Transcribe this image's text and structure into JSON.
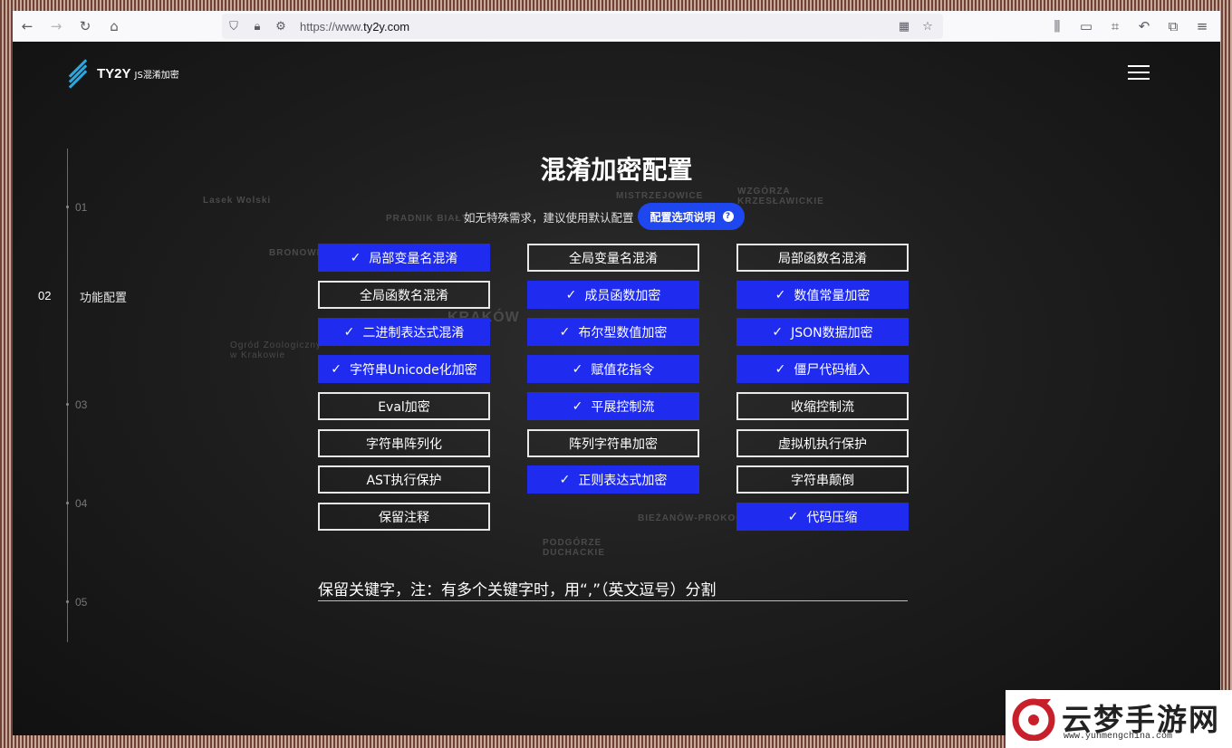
{
  "browser": {
    "url_scheme": "https://www.",
    "url_host": "ty2y.com"
  },
  "site": {
    "logo_name": "TY2Y",
    "logo_sub": "JS混淆加密"
  },
  "steps": [
    "01",
    "02",
    "03",
    "04",
    "05"
  ],
  "active_step": {
    "num": "02",
    "label": "功能配置"
  },
  "main": {
    "title": "混淆加密配置",
    "hint": "如无特殊需求，建议使用默认配置",
    "help_button": "配置选项说明",
    "help_icon": "?"
  },
  "options": {
    "col1": [
      {
        "label": "局部变量名混淆",
        "checked": true
      },
      {
        "label": "全局函数名混淆",
        "checked": false
      },
      {
        "label": "二进制表达式混淆",
        "checked": true
      },
      {
        "label": "字符串Unicode化加密",
        "checked": true
      },
      {
        "label": "Eval加密",
        "checked": false
      },
      {
        "label": "字符串阵列化",
        "checked": false
      },
      {
        "label": "AST执行保护",
        "checked": false
      },
      {
        "label": "保留注释",
        "checked": false
      }
    ],
    "col2": [
      {
        "label": "全局变量名混淆",
        "checked": false
      },
      {
        "label": "成员函数加密",
        "checked": true
      },
      {
        "label": "布尔型数值加密",
        "checked": true
      },
      {
        "label": "赋值花指令",
        "checked": true
      },
      {
        "label": "平展控制流",
        "checked": true
      },
      {
        "label": "阵列字符串加密",
        "checked": false
      },
      {
        "label": "正则表达式加密",
        "checked": true
      }
    ],
    "col3": [
      {
        "label": "局部函数名混淆",
        "checked": false
      },
      {
        "label": "数值常量加密",
        "checked": true
      },
      {
        "label": "JSON数据加密",
        "checked": true
      },
      {
        "label": "僵尸代码植入",
        "checked": true
      },
      {
        "label": "收缩控制流",
        "checked": false
      },
      {
        "label": "虚拟机执行保护",
        "checked": false
      },
      {
        "label": "字符串颠倒",
        "checked": false
      },
      {
        "label": "代码压缩",
        "checked": true
      }
    ]
  },
  "keywords": {
    "label": "保留关键字，注：有多个关键字时，用“,”（英文逗号）分割"
  },
  "map_labels": [
    "PRADNIK BIAŁY",
    "MISTRZEJOWICE",
    "BRONOWICE",
    "KRAKÓW",
    "Ogród Zoologiczny w Krakowie",
    "Lasek Wolski",
    "BIEŻANÓW-PROKOCIM",
    "PODGÓRZE DUCHACKIE",
    "WZGÓRZA KRZESŁAWICKIE"
  ],
  "watermark": {
    "title": "云梦手游网",
    "url": "www.yunmengchina.com"
  },
  "colors": {
    "accent": "#1f2cf0",
    "help_button": "#1f47f0",
    "logo": "#2aa8e0"
  }
}
